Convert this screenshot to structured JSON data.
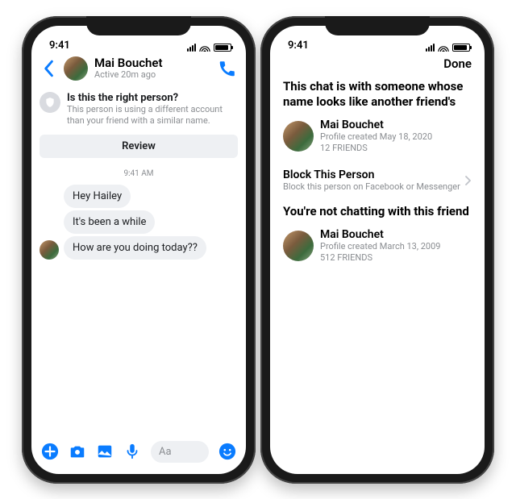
{
  "status": {
    "time": "9:41"
  },
  "chat": {
    "name": "Mai Bouchet",
    "presence": "Active 20m ago",
    "warning_title": "Is this the right person?",
    "warning_sub": "This person is using a different account than your friend with a similar name.",
    "review": "Review",
    "timestamp": "9:41 AM",
    "messages": [
      "Hey Hailey",
      "It's been a while",
      "How are you doing today??"
    ],
    "input_placeholder": "Aa"
  },
  "detail": {
    "done": "Done",
    "header1": "This chat is with someone whose name looks like another friend's",
    "suspect": {
      "name": "Mai Bouchet",
      "created": "Profile created May 18, 2020",
      "friends": "12 FRIENDS"
    },
    "block_title": "Block This Person",
    "block_sub": "Block this person on Facebook or Messenger",
    "header2": "You're not chatting with this friend",
    "real": {
      "name": "Mai Bouchet",
      "created": "Profile created March 13, 2009",
      "friends": "512 FRIENDS"
    }
  }
}
